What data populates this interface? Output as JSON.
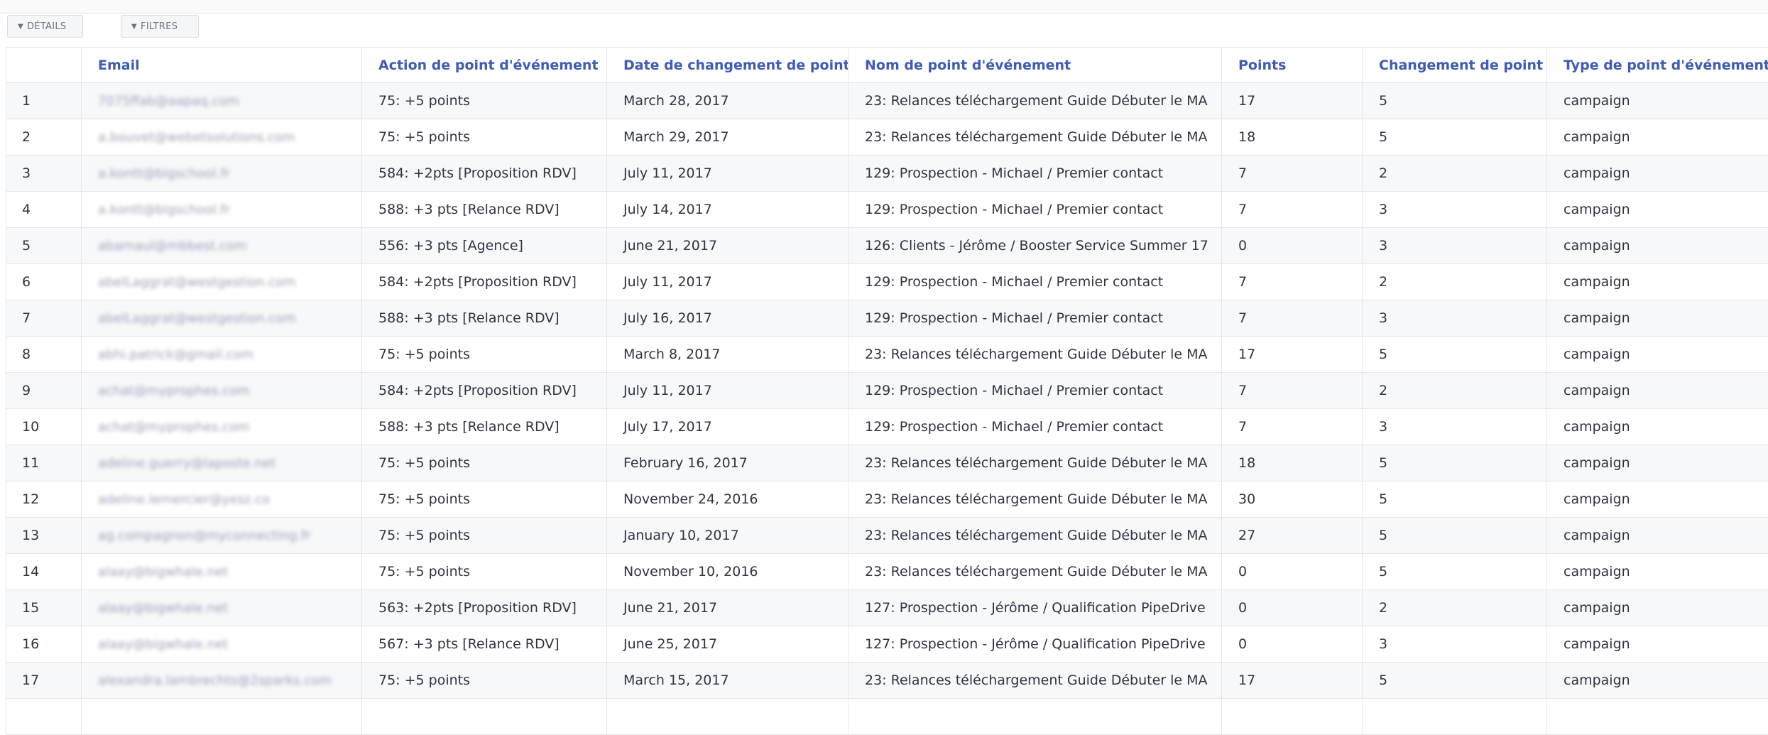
{
  "toolbar": {
    "details_label": "DÉTAILS",
    "filters_label": "FILTRES"
  },
  "table": {
    "columns": [
      "",
      "Email",
      "Action de point d'événement",
      "Date de changement de point",
      "Nom de point d'événement",
      "Points",
      "Changement de point",
      "Type de point d'événement"
    ],
    "rows": [
      {
        "idx": "1",
        "email": "7075ffab@aapaq.com",
        "action": "75: +5 points",
        "date": "March 28, 2017",
        "name": "23: Relances téléchargement Guide Débuter le MA",
        "points": "17",
        "change": "5",
        "type": "campaign"
      },
      {
        "idx": "2",
        "email": "a.bouvet@webetsolutions.com",
        "action": "75: +5 points",
        "date": "March 29, 2017",
        "name": "23: Relances téléchargement Guide Débuter le MA",
        "points": "18",
        "change": "5",
        "type": "campaign"
      },
      {
        "idx": "3",
        "email": "a.kontt@bigschool.fr",
        "action": "584: +2pts [Proposition RDV]",
        "date": "July 11, 2017",
        "name": "129: Prospection - Michael / Premier contact",
        "points": "7",
        "change": "2",
        "type": "campaign"
      },
      {
        "idx": "4",
        "email": "a.kontt@bigschool.fr",
        "action": "588: +3 pts [Relance RDV]",
        "date": "July 14, 2017",
        "name": "129: Prospection - Michael / Premier contact",
        "points": "7",
        "change": "3",
        "type": "campaign"
      },
      {
        "idx": "5",
        "email": "abarnaul@mbbest.com",
        "action": "556: +3 pts [Agence]",
        "date": "June 21, 2017",
        "name": "126: Clients - Jérôme / Booster Service Summer 17",
        "points": "0",
        "change": "3",
        "type": "campaign"
      },
      {
        "idx": "6",
        "email": "abelLaggrat@westgestion.com",
        "action": "584: +2pts [Proposition RDV]",
        "date": "July 11, 2017",
        "name": "129: Prospection - Michael / Premier contact",
        "points": "7",
        "change": "2",
        "type": "campaign"
      },
      {
        "idx": "7",
        "email": "abelLaggrat@westgestion.com",
        "action": "588: +3 pts [Relance RDV]",
        "date": "July 16, 2017",
        "name": "129: Prospection - Michael / Premier contact",
        "points": "7",
        "change": "3",
        "type": "campaign"
      },
      {
        "idx": "8",
        "email": "abhi.patrick@gmail.com",
        "action": "75: +5 points",
        "date": "March 8, 2017",
        "name": "23: Relances téléchargement Guide Débuter le MA",
        "points": "17",
        "change": "5",
        "type": "campaign"
      },
      {
        "idx": "9",
        "email": "achat@myprophes.com",
        "action": "584: +2pts [Proposition RDV]",
        "date": "July 11, 2017",
        "name": "129: Prospection - Michael / Premier contact",
        "points": "7",
        "change": "2",
        "type": "campaign"
      },
      {
        "idx": "10",
        "email": "achat@myprophes.com",
        "action": "588: +3 pts [Relance RDV]",
        "date": "July 17, 2017",
        "name": "129: Prospection - Michael / Premier contact",
        "points": "7",
        "change": "3",
        "type": "campaign"
      },
      {
        "idx": "11",
        "email": "adeline.guerry@laposte.net",
        "action": "75: +5 points",
        "date": "February 16, 2017",
        "name": "23: Relances téléchargement Guide Débuter le MA",
        "points": "18",
        "change": "5",
        "type": "campaign"
      },
      {
        "idx": "12",
        "email": "adeline.lemercier@yesz.co",
        "action": "75: +5 points",
        "date": "November 24, 2016",
        "name": "23: Relances téléchargement Guide Débuter le MA",
        "points": "30",
        "change": "5",
        "type": "campaign"
      },
      {
        "idx": "13",
        "email": "ag.compagnon@myconnecting.fr",
        "action": "75: +5 points",
        "date": "January 10, 2017",
        "name": "23: Relances téléchargement Guide Débuter le MA",
        "points": "27",
        "change": "5",
        "type": "campaign"
      },
      {
        "idx": "14",
        "email": "alaay@bigwhale.net",
        "action": "75: +5 points",
        "date": "November 10, 2016",
        "name": "23: Relances téléchargement Guide Débuter le MA",
        "points": "0",
        "change": "5",
        "type": "campaign"
      },
      {
        "idx": "15",
        "email": "alaay@bigwhale.net",
        "action": "563: +2pts [Proposition RDV]",
        "date": "June 21, 2017",
        "name": "127: Prospection - Jérôme / Qualification PipeDrive",
        "points": "0",
        "change": "2",
        "type": "campaign"
      },
      {
        "idx": "16",
        "email": "alaay@bigwhale.net",
        "action": "567: +3 pts [Relance RDV]",
        "date": "June 25, 2017",
        "name": "127: Prospection - Jérôme / Qualification PipeDrive",
        "points": "0",
        "change": "3",
        "type": "campaign"
      },
      {
        "idx": "17",
        "email": "alexandra.lambrechts@2sparks.com",
        "action": "75: +5 points",
        "date": "March 15, 2017",
        "name": "23: Relances téléchargement Guide Débuter le MA",
        "points": "17",
        "change": "5",
        "type": "campaign"
      },
      {
        "idx": "",
        "email": "",
        "action": "",
        "date": "",
        "name": "",
        "points": "",
        "change": "",
        "type": ""
      }
    ]
  }
}
